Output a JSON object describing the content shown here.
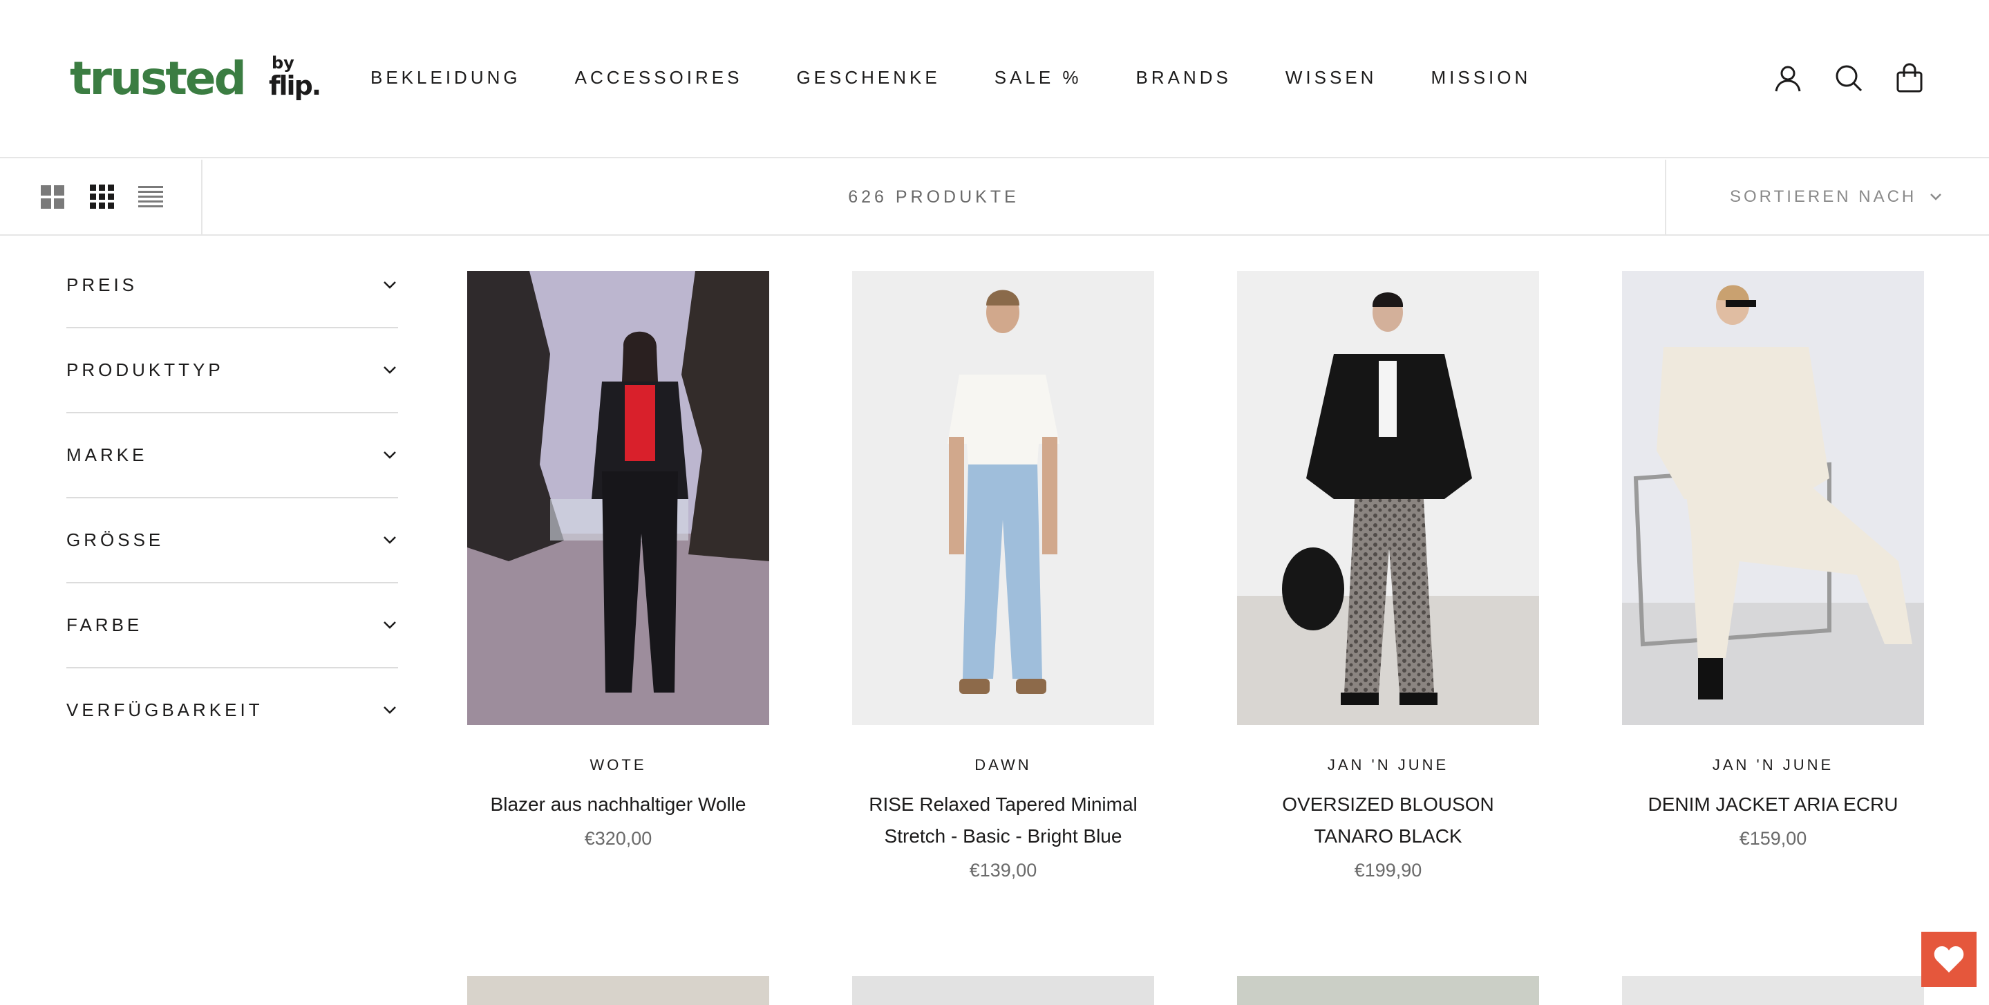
{
  "logo": {
    "main": "trusted",
    "by": "by",
    "flip": "flip."
  },
  "nav": [
    "BEKLEIDUNG",
    "ACCESSOIRES",
    "GESCHENKE",
    "SALE %",
    "BRANDS",
    "WISSEN",
    "MISSION"
  ],
  "header_icons": [
    "account-icon",
    "search-icon",
    "bag-icon"
  ],
  "toolbar": {
    "product_count": "626 PRODUKTE",
    "sort_label": "SORTIEREN NACH"
  },
  "filters": [
    "PREIS",
    "PRODUKTTYP",
    "MARKE",
    "GRÖSSE",
    "FARBE",
    "VERFÜGBARKEIT"
  ],
  "products": [
    {
      "brand": "WOTE",
      "title": "Blazer aus nachhaltiger Wolle",
      "price": "€320,00"
    },
    {
      "brand": "DAWN",
      "title": "RISE Relaxed Tapered Minimal Stretch - Basic - Bright Blue",
      "price": "€139,00"
    },
    {
      "brand": "JAN 'N JUNE",
      "title": "OVERSIZED BLOUSON TANARO BLACK",
      "price": "€199,90"
    },
    {
      "brand": "JAN 'N JUNE",
      "title": "DENIM JACKET ARIA ECRU",
      "price": "€159,00"
    }
  ],
  "colors": {
    "brand_green": "#3b7d42",
    "accent": "#e5573c",
    "muted": "#6a6a6a"
  }
}
